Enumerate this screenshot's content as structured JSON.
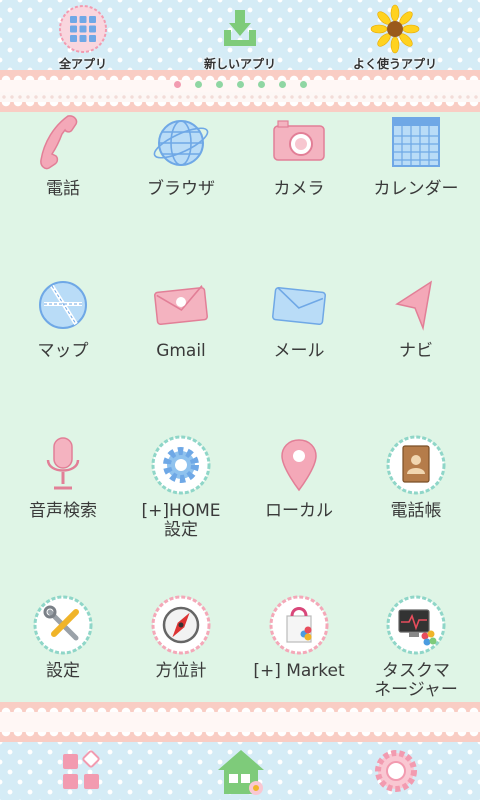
{
  "top_bar": {
    "items": [
      {
        "label": "全アプリ",
        "icon": "all-apps-grid-icon"
      },
      {
        "label": "新しいアプリ",
        "icon": "new-apps-download-icon"
      },
      {
        "label": "よく使うアプリ",
        "icon": "sunflower-favorites-icon"
      }
    ]
  },
  "pager": {
    "page_count": 7,
    "current_page": 1
  },
  "apps": [
    {
      "label": "電話",
      "icon": "phone-icon"
    },
    {
      "label": "ブラウザ",
      "icon": "globe-icon"
    },
    {
      "label": "カメラ",
      "icon": "camera-icon"
    },
    {
      "label": "カレンダー",
      "icon": "calendar-icon"
    },
    {
      "label": "マップ",
      "icon": "map-icon"
    },
    {
      "label": "Gmail",
      "icon": "gmail-envelope-icon"
    },
    {
      "label": "メール",
      "icon": "mail-envelope-icon"
    },
    {
      "label": "ナビ",
      "icon": "navigation-arrow-icon"
    },
    {
      "label": "音声検索",
      "icon": "microphone-icon"
    },
    {
      "label": "[+]HOME\n設定",
      "icon": "gear-icon"
    },
    {
      "label": "ローカル",
      "icon": "location-pin-icon"
    },
    {
      "label": "電話帳",
      "icon": "contacts-book-icon"
    },
    {
      "label": "設定",
      "icon": "tools-icon"
    },
    {
      "label": "方位計",
      "icon": "compass-icon"
    },
    {
      "label": "[+] Market",
      "icon": "market-bag-icon"
    },
    {
      "label": "タスクマ\nネージャー",
      "icon": "task-manager-monitor-icon"
    }
  ],
  "dock": {
    "items": [
      {
        "icon": "app-drawer-grid-icon"
      },
      {
        "icon": "home-house-icon"
      },
      {
        "icon": "settings-flower-icon"
      }
    ]
  },
  "colors": {
    "sky": "#d5ecf6",
    "mint": "#dff5e6",
    "pink": "#f29bb0",
    "blue": "#8fc2ee",
    "lace_pink": "#f9cdc4"
  }
}
